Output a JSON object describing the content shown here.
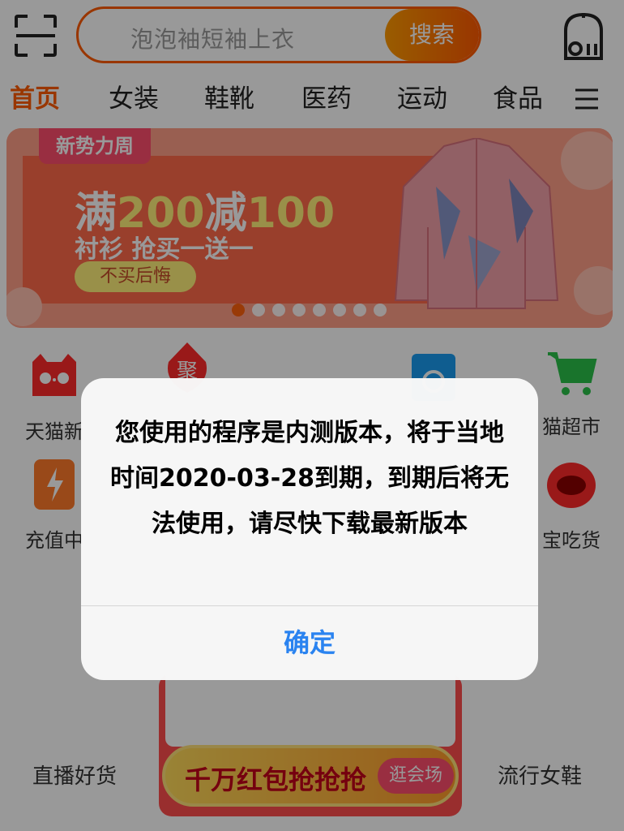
{
  "header": {
    "search_placeholder": "泡泡袖短袖上衣",
    "search_button": "搜索",
    "scan_icon": "scan-icon",
    "message_icon": "message-icon"
  },
  "tabs": [
    {
      "label": "首页",
      "active": true
    },
    {
      "label": "女装",
      "active": false
    },
    {
      "label": "鞋靴",
      "active": false
    },
    {
      "label": "医药",
      "active": false
    },
    {
      "label": "运动",
      "active": false
    },
    {
      "label": "食品",
      "active": false
    }
  ],
  "tabs_menu_icon": "menu-icon",
  "banner": {
    "tag": "新势力周",
    "title_part1": "满",
    "title_part2": "200",
    "title_part3": "减",
    "title_part4": "100",
    "subtitle": "衬衫 抢买一送一",
    "button": "不买后悔",
    "slide_count": 8,
    "active_slide": 0
  },
  "grid": [
    {
      "label": "天猫新",
      "icon": "tmall-icon"
    },
    {
      "label": "聚",
      "icon": "juhuasuan-icon"
    },
    {
      "label": "",
      "icon": "ele-icon"
    },
    {
      "label": "猫超市",
      "icon": "cart-icon"
    },
    {
      "label": "充值中",
      "icon": "recharge-icon"
    },
    {
      "label": "宝吃货",
      "icon": "food-icon"
    }
  ],
  "bottom": {
    "left_label": "直播好货",
    "right_label": "流行女鞋",
    "promo_text": "千万红包抢抢抢",
    "promo_button": "逛会场"
  },
  "alert": {
    "message": "您使用的程序是内测版本，将于当地时间2020-03-28到期，到期后将无法使用，请尽快下载最新版本",
    "button": "确定"
  },
  "colors": {
    "accent": "#ff5a00",
    "alert_button": "#2a83f0"
  }
}
